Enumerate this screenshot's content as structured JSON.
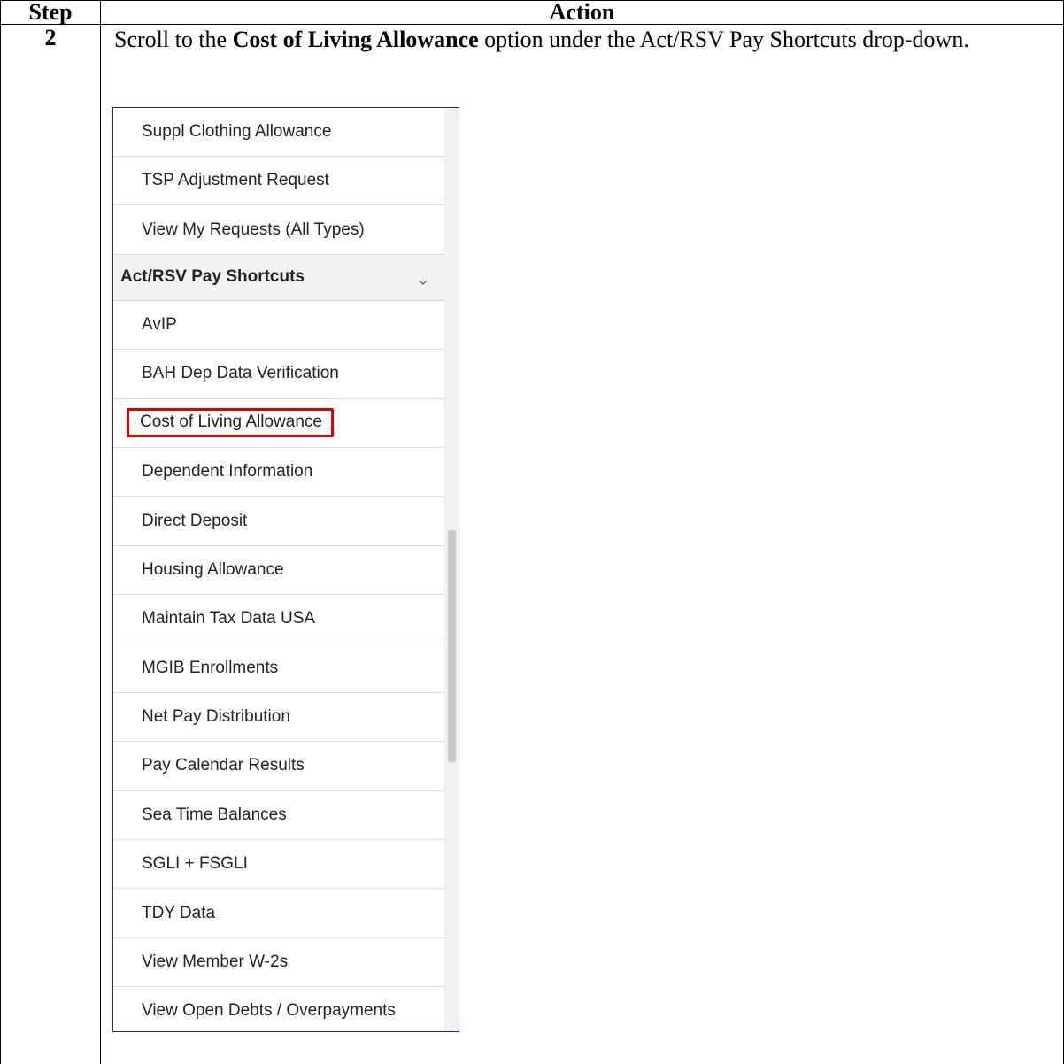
{
  "table": {
    "header": {
      "step": "Step",
      "action": "Action"
    },
    "step_number": "2",
    "instruction": {
      "before": "Scroll to the ",
      "bold": "Cost of Living Allowance",
      "after": " option under the Act/RSV Pay Shortcuts drop-down."
    }
  },
  "dropdown": {
    "items_above": [
      "Suppl Clothing Allowance",
      "TSP Adjustment Request",
      "View My Requests (All Types)"
    ],
    "section_header": "Act/RSV Pay Shortcuts",
    "section_icon": "chevron-down-icon",
    "items": [
      "AvIP",
      "BAH Dep Data Verification",
      "Cost of Living Allowance",
      "Dependent Information",
      "Direct Deposit",
      "Housing Allowance",
      "Maintain Tax Data USA",
      "MGIB Enrollments",
      "Net Pay Distribution",
      "Pay Calendar Results",
      "Sea Time Balances",
      "SGLI + FSGLI",
      "TDY Data",
      "View Member W-2s",
      "View Open Debts / Overpayments"
    ],
    "highlighted_item": "Cost of Living Allowance",
    "highlight_color": "#e00000",
    "border_color": "#1a2ab8"
  }
}
